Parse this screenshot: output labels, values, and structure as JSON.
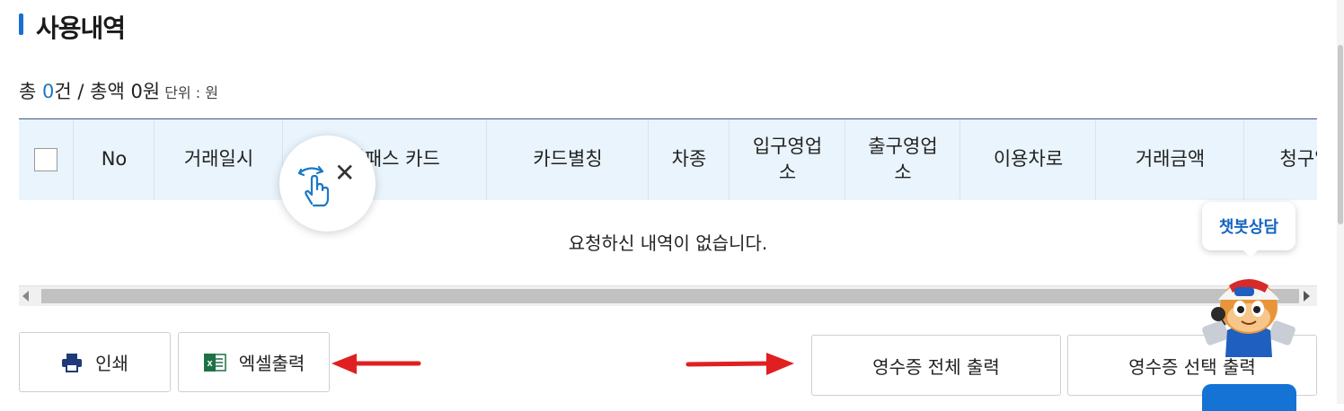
{
  "page": {
    "title": "사용내역"
  },
  "summary": {
    "prefix": "총 ",
    "count": "0",
    "count_suffix": "건 / 총액 ",
    "amount": "0원",
    "unit_label": " 단위 : 원"
  },
  "table": {
    "columns": [
      "No",
      "거래일시",
      "하이패스 카드",
      "카드별칭",
      "차종",
      "입구영업\n소",
      "출구영업\n소",
      "이용차로",
      "거래금액",
      "청구일"
    ],
    "empty_message": "요청하신 내역이 없습니다."
  },
  "buttons": {
    "print": "인쇄",
    "excel": "엑셀출력",
    "receipt_all": "영수증 전체 출력",
    "receipt_selected": "영수증 선택 출력"
  },
  "chatbot": {
    "label": "챗봇상담"
  },
  "colors": {
    "accent": "#1a6fd1",
    "header_bg": "#e9f4fc",
    "arrow": "#e02020"
  },
  "icons": [
    "printer-icon",
    "excel-icon",
    "swipe-hand-icon",
    "close-icon"
  ]
}
